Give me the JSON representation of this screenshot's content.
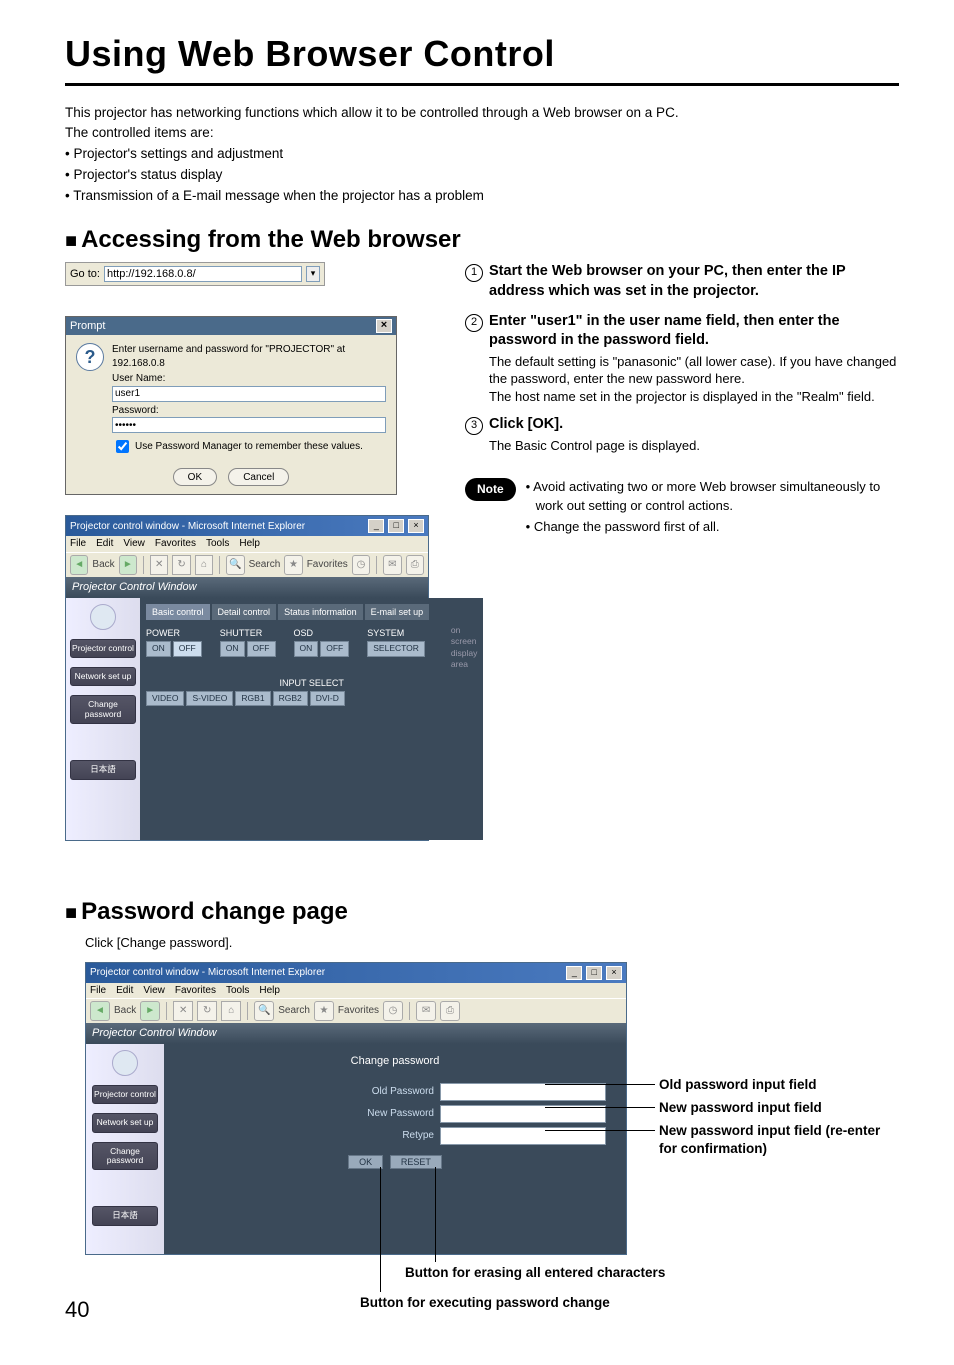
{
  "page_number": "40",
  "title": "Using Web Browser Control",
  "intro": {
    "line1": "This projector has networking functions which allow it to be controlled through a Web browser on a PC.",
    "line2": "The controlled items are:",
    "bullets": [
      "• Projector's settings and adjustment",
      "• Projector's status display",
      "• Transmission of a E-mail message when the projector has a problem"
    ]
  },
  "section1": {
    "heading": "Accessing from the Web browser",
    "goto_label": "Go to:",
    "goto_value": "http://192.168.0.8/",
    "prompt": {
      "title": "Prompt",
      "message": "Enter username and password for \"PROJECTOR\" at 192.168.0.8",
      "user_label": "User Name:",
      "user_value": "user1",
      "pass_label": "Password:",
      "pass_value": "••••••",
      "remember": "Use Password Manager to remember these values.",
      "ok": "OK",
      "cancel": "Cancel"
    },
    "ie": {
      "title": "Projector control window - Microsoft Internet Explorer",
      "menu": [
        "File",
        "Edit",
        "View",
        "Favorites",
        "Tools",
        "Help"
      ],
      "toolbar_back": "Back",
      "toolbar_search": "Search",
      "toolbar_fav": "Favorites",
      "header": "Projector Control Window",
      "sidebar": {
        "projector": "Projector control",
        "network": "Network set up",
        "change": "Change password",
        "japanese": "日本語"
      },
      "tabs": {
        "basic": "Basic control",
        "detail": "Detail control",
        "status": "Status information",
        "email": "E-mail set up"
      },
      "controls": {
        "power": "POWER",
        "shutter": "SHUTTER",
        "osd": "OSD",
        "system": "SYSTEM",
        "on": "ON",
        "off": "OFF",
        "selector": "SELECTOR",
        "input_select": "INPUT SELECT",
        "video": "VIDEO",
        "svideo": "S-VIDEO",
        "rgb1": "RGB1",
        "rgb2": "RGB2",
        "dvid": "DVI-D",
        "osdisplay": "on screen display area"
      }
    },
    "steps": [
      {
        "num": "1",
        "title": "Start the Web browser on your PC, then enter the IP address which was set in the projector."
      },
      {
        "num": "2",
        "title": "Enter \"user1\" in the user name field, then enter the password in the password field.",
        "desc": "The default setting is \"panasonic\" (all lower case). If you have changed the password, enter the new password here.\nThe host name set in the projector is displayed in the \"Realm\" field."
      },
      {
        "num": "3",
        "title": "Click [OK].",
        "desc": "The Basic Control page is displayed."
      }
    ],
    "note_label": "Note",
    "notes": [
      "• Avoid activating two or more Web browser simultaneously to work out setting or control actions.",
      "• Change the password first of all."
    ]
  },
  "section2": {
    "heading": "Password change page",
    "click_text": "Click [Change password].",
    "panel": {
      "title": "Change password",
      "old": "Old Password",
      "new": "New Password",
      "retype": "Retype",
      "ok": "OK",
      "reset": "RESET"
    },
    "annotations": {
      "old": "Old password input field",
      "new": "New password input field",
      "retype": "New password input field (re-enter for confirmation)",
      "reset": "Button for erasing all entered characters",
      "ok": "Button for executing password change"
    }
  }
}
